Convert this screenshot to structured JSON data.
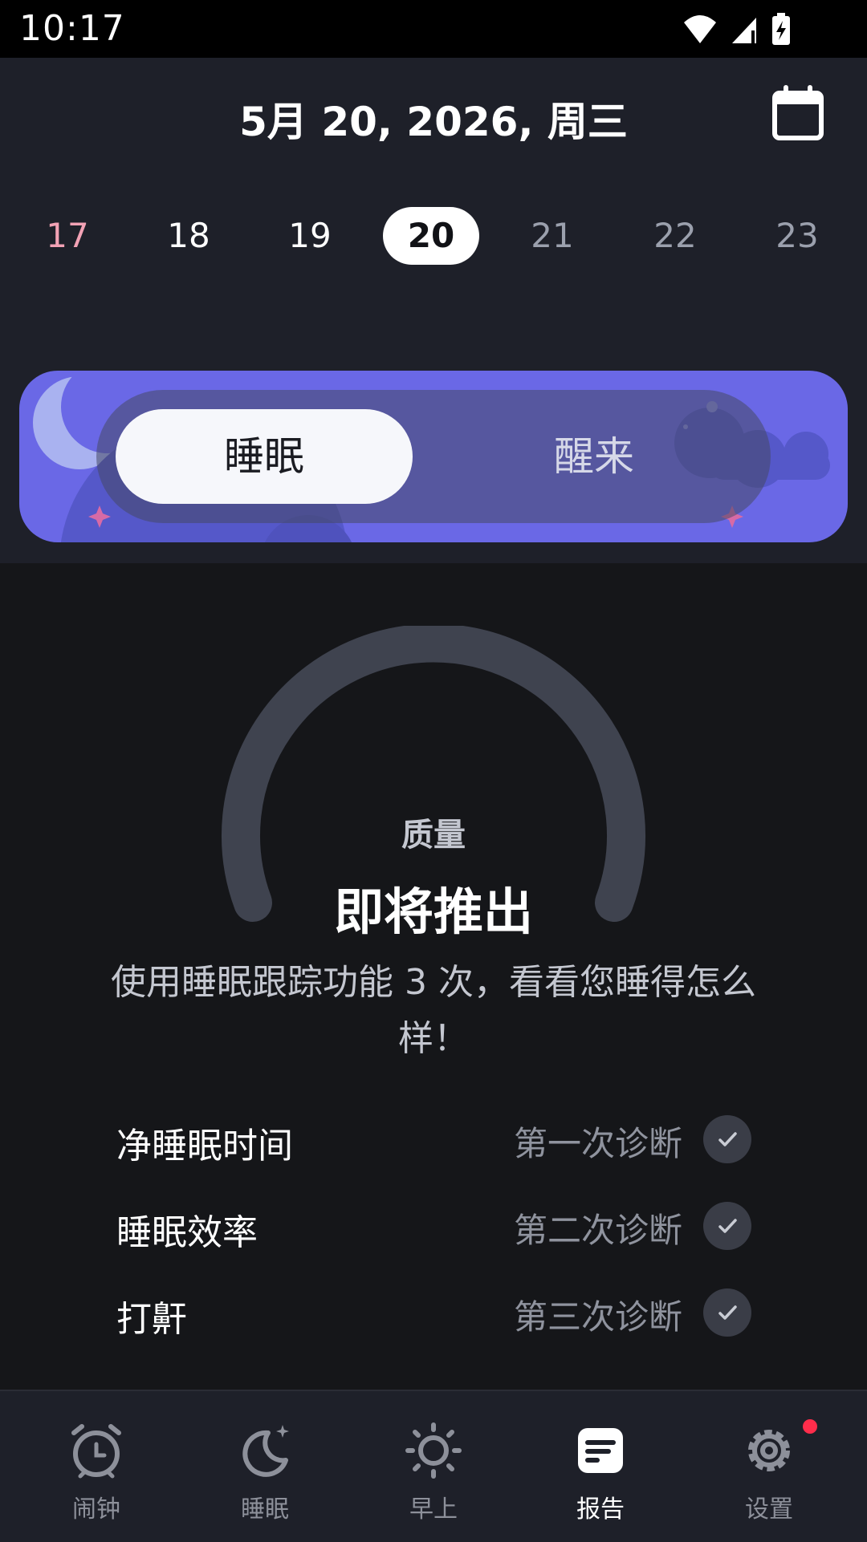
{
  "status_bar": {
    "time": "10:17",
    "icons": [
      "wifi-icon",
      "cell-signal-icon",
      "battery-charging-icon"
    ]
  },
  "header": {
    "date_title": "5月 20, 2026, 周三",
    "calendar_icon": "calendar-icon",
    "days": [
      {
        "label": "17",
        "state": "weekend"
      },
      {
        "label": "18",
        "state": "past"
      },
      {
        "label": "19",
        "state": "past"
      },
      {
        "label": "20",
        "state": "selected"
      },
      {
        "label": "21",
        "state": "future"
      },
      {
        "label": "22",
        "state": "future"
      },
      {
        "label": "23",
        "state": "future"
      }
    ]
  },
  "toggle": {
    "sleep_label": "睡眠",
    "wake_label": "醒来",
    "active": "sleep"
  },
  "quality": {
    "label": "质量",
    "value": "即将推出",
    "description": "使用睡眠跟踪功能 3 次，看看您睡得怎么样！"
  },
  "metrics": [
    {
      "name": "净睡眠时间",
      "status": "第一次诊断",
      "icon": "check-icon"
    },
    {
      "name": "睡眠效率",
      "status": "第二次诊断",
      "icon": "check-icon"
    },
    {
      "name": "打鼾",
      "status": "第三次诊断",
      "icon": "check-icon"
    }
  ],
  "bottom_nav": [
    {
      "label": "闹钟",
      "icon": "alarm-clock-icon",
      "active": false
    },
    {
      "label": "睡眠",
      "icon": "moon-icon",
      "active": false
    },
    {
      "label": "早上",
      "icon": "sun-icon",
      "active": false
    },
    {
      "label": "报告",
      "icon": "report-icon",
      "active": true
    },
    {
      "label": "设置",
      "icon": "gear-icon",
      "active": false,
      "badge": true
    }
  ],
  "colors": {
    "accent": "#6a68e6",
    "background": "#151619",
    "header_bg": "#1e2029",
    "badge": "#ff2d4b"
  }
}
